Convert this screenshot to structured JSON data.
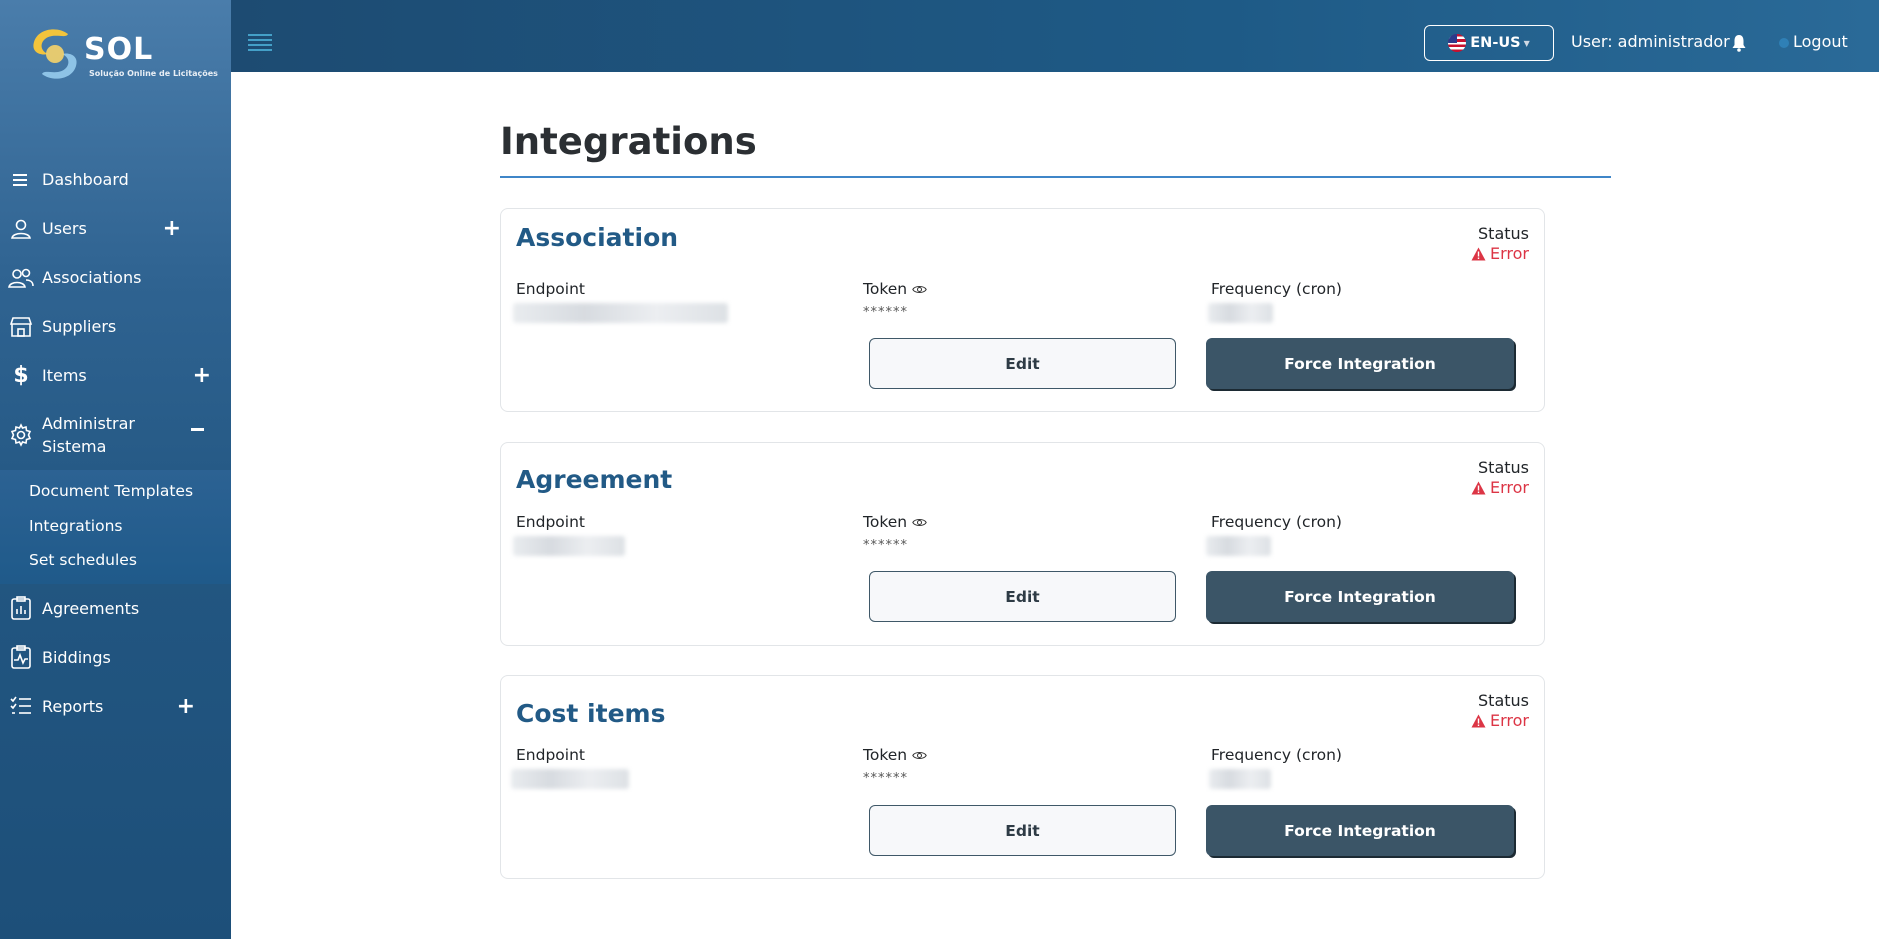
{
  "brand": {
    "name": "SOL",
    "tagline": "Solução Online de Licitações"
  },
  "sidebar": {
    "items": [
      {
        "label": "Dashboard"
      },
      {
        "label": "Users"
      },
      {
        "label": "Associations"
      },
      {
        "label": "Suppliers"
      },
      {
        "label": "Items"
      },
      {
        "label": "Administrar Sistema"
      },
      {
        "label": "Agreements"
      },
      {
        "label": "Biddings"
      },
      {
        "label": "Reports"
      }
    ],
    "submenu": [
      {
        "label": "Document Templates"
      },
      {
        "label": "Integrations"
      },
      {
        "label": "Set schedules"
      }
    ]
  },
  "topbar": {
    "language": "EN-US",
    "user": "User: administrador",
    "logout": "Logout"
  },
  "page": {
    "title": "Integrations"
  },
  "labels": {
    "status": "Status",
    "endpoint": "Endpoint",
    "token": "Token",
    "frequency": "Frequency (cron)",
    "masked_token": "******",
    "edit": "Edit",
    "force": "Force Integration"
  },
  "integrations": [
    {
      "name": "Association",
      "status": "Error"
    },
    {
      "name": "Agreement",
      "status": "Error"
    },
    {
      "name": "Cost items",
      "status": "Error"
    }
  ],
  "colors": {
    "sidebar": "#225681",
    "accent": "#225a86",
    "error": "#dc3545",
    "primary_button": "#3b5567"
  }
}
